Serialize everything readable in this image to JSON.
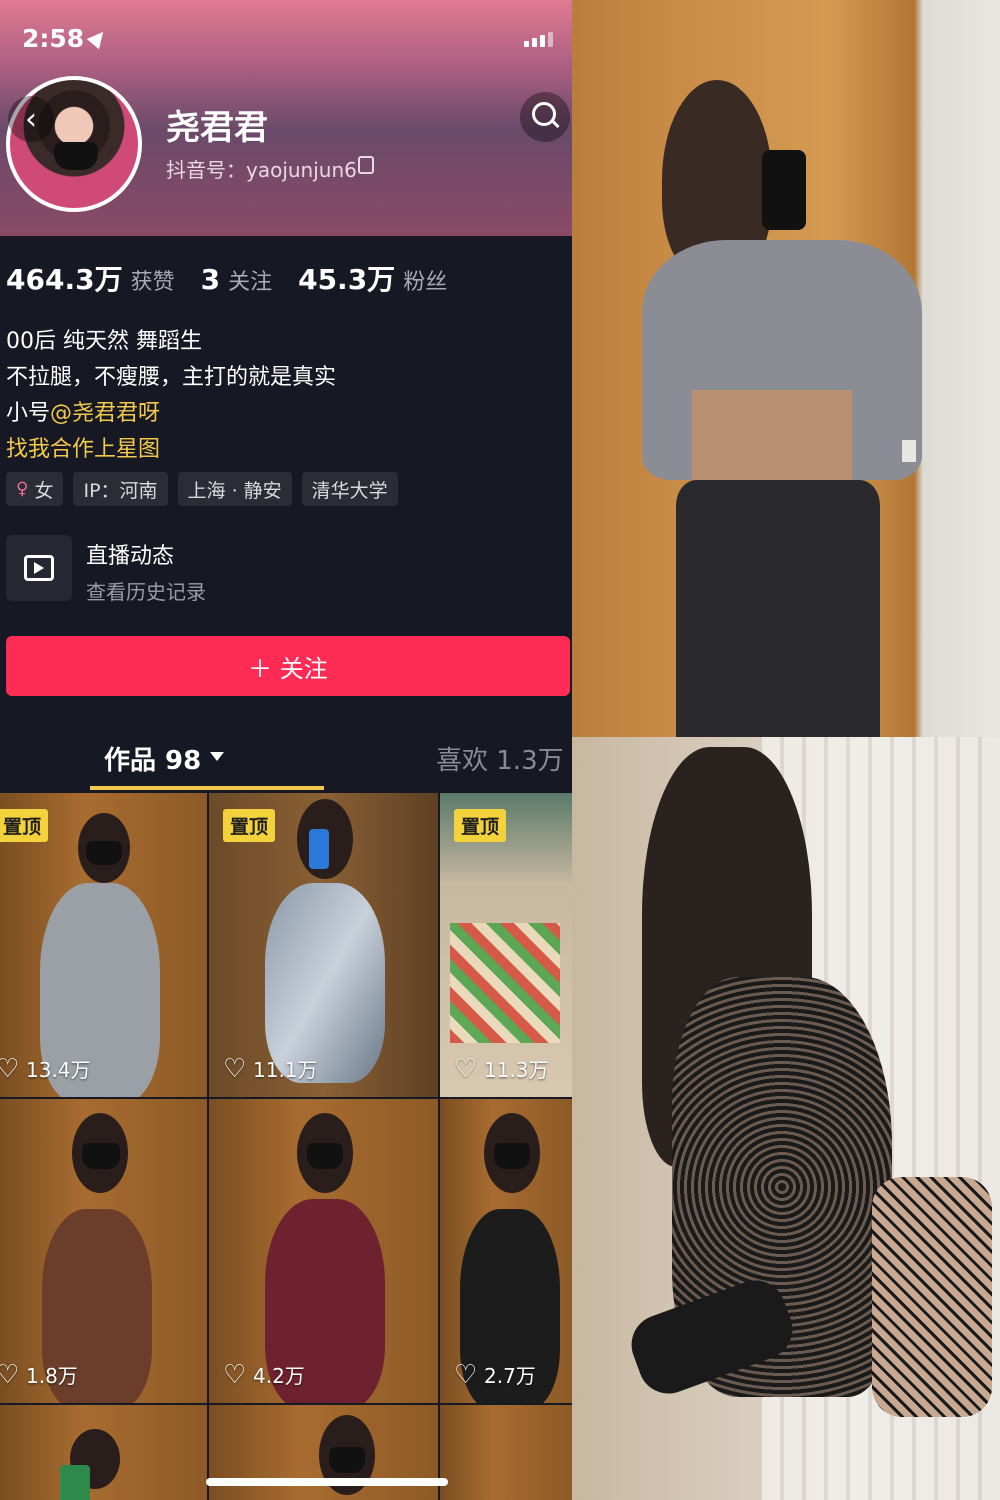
{
  "status_bar": {
    "time": "2:58"
  },
  "profile": {
    "name": "尧君君",
    "account_id": "抖音号：yaojunjun6",
    "stats": [
      {
        "value": "464.3万",
        "label": "获赞"
      },
      {
        "value": "3",
        "label": "关注"
      },
      {
        "value": "45.3万",
        "label": "粉丝"
      }
    ],
    "bio": {
      "line1": "00后 纯天然 舞蹈生",
      "line2": "不拉腿，不瘦腰，主打的就是真实",
      "line3_prefix": "小号",
      "line3_link": "@尧君君呀",
      "line4": "找我合作上星图"
    },
    "tags": {
      "gender": "女",
      "ip": "IP：河南",
      "location": "上海 · 静安",
      "school": "清华大学"
    },
    "live": {
      "title": "直播动态",
      "subtitle": "查看历史记录"
    },
    "follow_label": "＋ 关注"
  },
  "tabs": {
    "works": "作品 98",
    "likes": "喜欢 1.3万"
  },
  "videos": [
    {
      "pinned": "置顶",
      "likes": "13.4万"
    },
    {
      "pinned": "置顶",
      "likes": "11.1万"
    },
    {
      "pinned": "置顶",
      "likes": "11.3万"
    },
    {
      "pinned": "",
      "likes": "1.8万"
    },
    {
      "pinned": "",
      "likes": "4.2万"
    },
    {
      "pinned": "",
      "likes": "2.7万"
    }
  ],
  "colors": {
    "accent": "#fe2c55",
    "pin": "#f4d23c",
    "link": "#f2c94c",
    "background": "#161823"
  },
  "icons": [
    "back-icon",
    "search-icon",
    "copy-icon",
    "tv-icon",
    "heart-icon",
    "female-icon",
    "location-arrow-icon"
  ]
}
